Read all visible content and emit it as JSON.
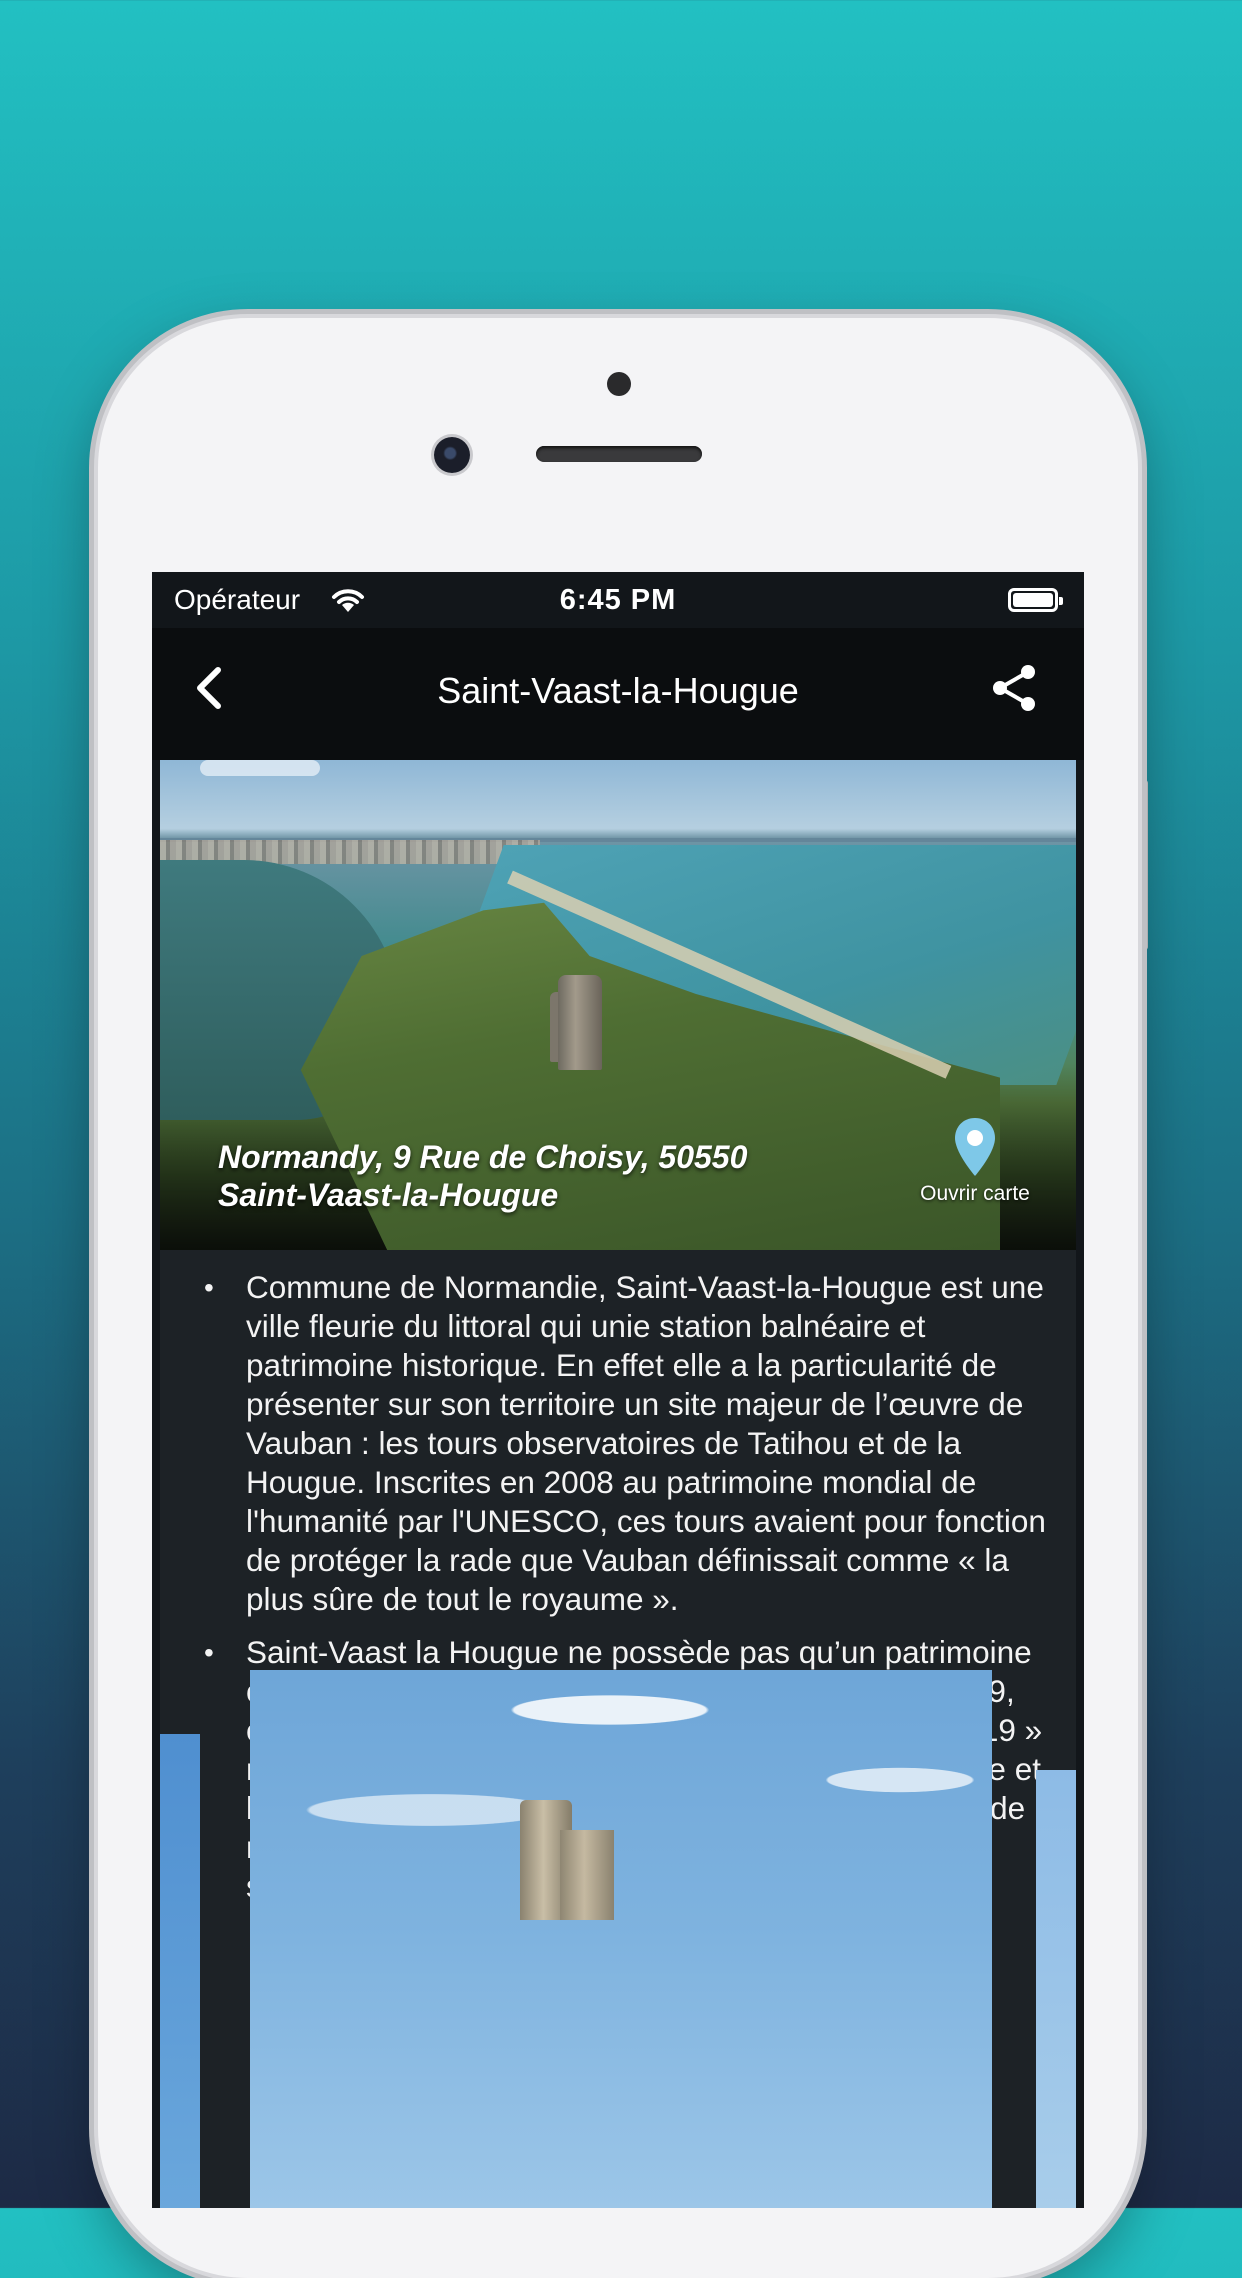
{
  "status_bar": {
    "carrier": "Opérateur",
    "time": "6:45 PM"
  },
  "nav": {
    "title": "Saint-Vaast-la-Hougue",
    "back_icon": "chevron-left-icon",
    "share_icon": "share-icon"
  },
  "hero": {
    "address_line1": "Normandy, 9 Rue de Choisy, 50550",
    "address_line2": "Saint-Vaast-la-Hougue",
    "map_button_label": "Ouvrir carte",
    "pin_color": "#7ec8e8"
  },
  "content": {
    "paragraphs": [
      "Commune de Normandie, Saint-Vaast-la-Hougue est une ville fleurie du littoral qui unie station balnéaire et patrimoine historique. En effet elle a la particularité de présenter sur son territoire un site majeur de l’œuvre de Vauban : les tours observatoires de Tatihou et de la Hougue. Inscrites en 2008 au patrimoine mondial de l'humanité par l'UNESCO, ces tours avaient pour fonction de protéger la rade que Vauban définissait comme « la plus sûre de tout le royaume ».",
      "Saint-Vaast la Hougue ne possède pas qu’un patrimoine culturel mais aussi une nature préservée. En juin 2019, elle est même élue « Village préféré des Français 2019 » mettant alors à l’honneur la douceur de vivre ambiante et la gastronomie de la ville. Berceau de l’huître normande nouvelle, cette ville vous réserve de nombreuses surprises."
    ],
    "bullet": "•"
  },
  "colors": {
    "background_top": "#22c0c2",
    "background_bottom": "#1d2a45",
    "navbar": "#0b0d0f",
    "content_bg": "#1d2226"
  }
}
